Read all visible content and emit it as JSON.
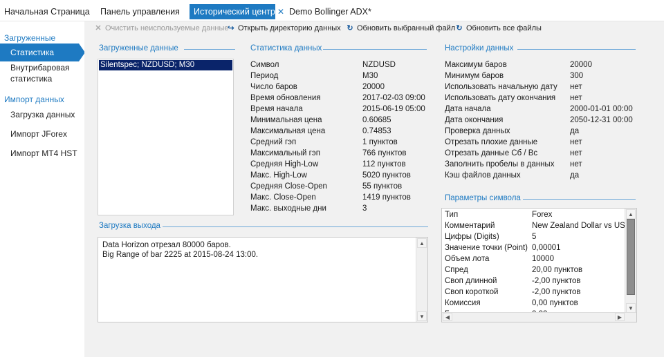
{
  "tabs": {
    "home": "Начальная Страница",
    "dashboard": "Панель управления",
    "history": "Исторический центр",
    "demo": "Demo Bollinger ADX*"
  },
  "sidebar": {
    "group1": "Загруженные файлы",
    "item_stats": "Статистика данных",
    "item_intrabar": "Внутрибаровая статистика",
    "group2": "Импорт данных",
    "item_load": "Загрузка данных",
    "item_jforex": "Импорт JForex",
    "item_mt4": "Импорт MT4 HST"
  },
  "toolbar": {
    "clear": "Очистить неиспользуемые данные",
    "open_dir": "Открыть директорию данных",
    "refresh_selected": "Обновить выбранный файл",
    "refresh_all": "Обновить все файлы"
  },
  "loaded": {
    "title": "Загруженные данные",
    "items": [
      "Silentspec; NZDUSD; M30"
    ]
  },
  "stats": {
    "title": "Статистика данных",
    "rows": [
      {
        "k": "Символ",
        "v": "NZDUSD"
      },
      {
        "k": "Период",
        "v": "M30"
      },
      {
        "k": "Число баров",
        "v": "20000"
      },
      {
        "k": "Время обновления",
        "v": "2017-02-03 09:00"
      },
      {
        "k": "Время начала",
        "v": "2015-06-19 05:00"
      },
      {
        "k": "Минимальная цена",
        "v": "0.60685"
      },
      {
        "k": "Максимальная цена",
        "v": "0.74853"
      },
      {
        "k": "Средний гэп",
        "v": "1 пунктов"
      },
      {
        "k": "Максимальный гэп",
        "v": "766 пунктов"
      },
      {
        "k": "Средняя High-Low",
        "v": "112 пунктов"
      },
      {
        "k": "Макс. High-Low",
        "v": "5020 пунктов"
      },
      {
        "k": "Средняя Close-Open",
        "v": "55 пунктов"
      },
      {
        "k": "Макс. Close-Open",
        "v": "1419 пунктов"
      },
      {
        "k": "Макс. выходные дни",
        "v": "3"
      }
    ]
  },
  "settings": {
    "title": "Настройки данных",
    "rows": [
      {
        "k": "Максимум баров",
        "v": "20000"
      },
      {
        "k": "Минимум баров",
        "v": "300"
      },
      {
        "k": "Использовать начальную дату",
        "v": "нет"
      },
      {
        "k": "Использовать дату окончания",
        "v": "нет"
      },
      {
        "k": "Дата начала",
        "v": "2000-01-01 00:00"
      },
      {
        "k": "Дата окончания",
        "v": "2050-12-31 00:00"
      },
      {
        "k": "Проверка данных",
        "v": "да"
      },
      {
        "k": "Отрезать плохие данные",
        "v": "нет"
      },
      {
        "k": "Отрезать данные Сб / Вс",
        "v": "нет"
      },
      {
        "k": "Заполнить пробелы в данных",
        "v": "нет"
      },
      {
        "k": "Кэш файлов данных",
        "v": "да"
      }
    ]
  },
  "output": {
    "title": "Загрузка выхода",
    "lines": [
      "Data Horizon отрезал 80000 баров.",
      "Big Range of bar 2225 at 2015-08-24 13:00."
    ]
  },
  "symbol": {
    "title": "Параметры символа",
    "rows": [
      {
        "k": "Тип",
        "v": "Forex"
      },
      {
        "k": "Комментарий",
        "v": "New Zealand Dollar vs US D"
      },
      {
        "k": "Цифры (Digits)",
        "v": "5"
      },
      {
        "k": "Значение точки (Point)",
        "v": "0,00001"
      },
      {
        "k": "Объем лота",
        "v": "10000"
      },
      {
        "k": "Спред",
        "v": "20,00 пунктов"
      },
      {
        "k": "Своп длинной",
        "v": "-2,00 пунктов"
      },
      {
        "k": "Своп короткой",
        "v": "-2,00 пунктов"
      },
      {
        "k": "Комиссия",
        "v": "0,00 пунктов"
      },
      {
        "k": "Г",
        "v": "0,00"
      }
    ]
  },
  "icons": {
    "clear": "close-icon",
    "open_dir": "open-arrow-icon",
    "refresh": "refresh-icon"
  },
  "colors": {
    "accent": "#1e7ac2",
    "selection": "#0a246a"
  }
}
